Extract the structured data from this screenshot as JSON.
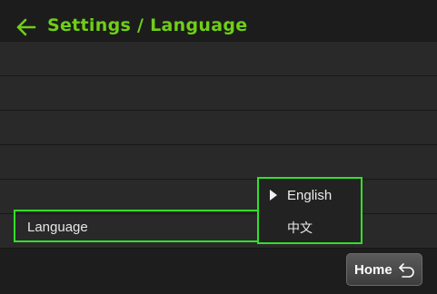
{
  "header": {
    "title": "Settings / Language",
    "back_icon": "arrow-left-icon",
    "accent_color": "#6fcf17"
  },
  "settings": {
    "language_label": "Language"
  },
  "language_dropdown": {
    "options": [
      {
        "label": "English",
        "selected": true,
        "icon": "caret-right-icon"
      },
      {
        "label": "中文",
        "selected": false
      }
    ],
    "highlight_color": "#32e02a"
  },
  "footer": {
    "home_label": "Home",
    "home_icon": "undo-arrow-icon"
  }
}
